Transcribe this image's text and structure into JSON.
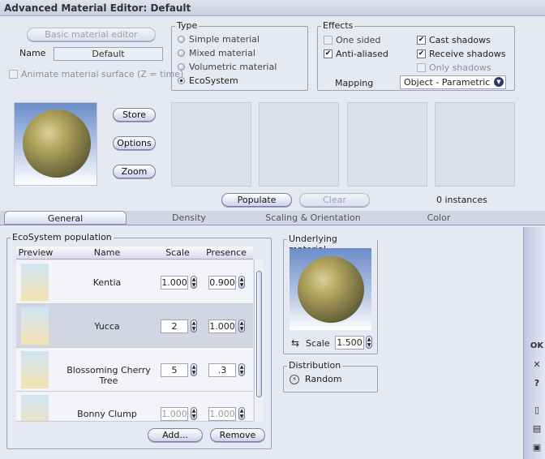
{
  "window": {
    "title": "Advanced Material Editor: Default"
  },
  "top": {
    "basic_button": "Basic material editor",
    "name_label": "Name",
    "name_value": "Default",
    "animate_label": "Animate material surface (Z = time)"
  },
  "type_group": {
    "title": "Type",
    "options": [
      "Simple material",
      "Mixed material",
      "Volumetric material",
      "EcoSystem"
    ],
    "selected": "EcoSystem"
  },
  "effects_group": {
    "title": "Effects",
    "one_sided": "One sided",
    "anti_aliased": "Anti-aliased",
    "cast_shadows": "Cast shadows",
    "receive_shadows": "Receive shadows",
    "only_shadows": "Only shadows",
    "mapping_label": "Mapping",
    "mapping_value": "Object - Parametric"
  },
  "preview_buttons": {
    "store": "Store",
    "options": "Options",
    "zoom": "Zoom"
  },
  "populate": {
    "populate_label": "Populate",
    "clear_label": "Clear",
    "instances": "0 instances"
  },
  "tabs": [
    "General",
    "Density",
    "Scaling & Orientation",
    "Color"
  ],
  "ecosystem": {
    "title": "EcoSystem population",
    "headers": {
      "preview": "Preview",
      "name": "Name",
      "scale": "Scale",
      "presence": "Presence"
    },
    "rows": [
      {
        "name": "Kentia",
        "scale": "1.000",
        "presence": "0.900"
      },
      {
        "name": "Yucca",
        "scale": "2",
        "presence": "1.000"
      },
      {
        "name": "Blossoming Cherry Tree",
        "scale": "5",
        "presence": ".3"
      },
      {
        "name": "Bonny Clump",
        "scale": "1.000",
        "presence": "1.000"
      }
    ],
    "add_label": "Add...",
    "remove_label": "Remove"
  },
  "underlying": {
    "title": "Underlying material",
    "scale_label": "Scale",
    "scale_value": "1.500"
  },
  "distribution": {
    "title": "Distribution",
    "value": "Random"
  },
  "right_bar": {
    "ok": "OK",
    "close": "✕",
    "help": "?"
  }
}
